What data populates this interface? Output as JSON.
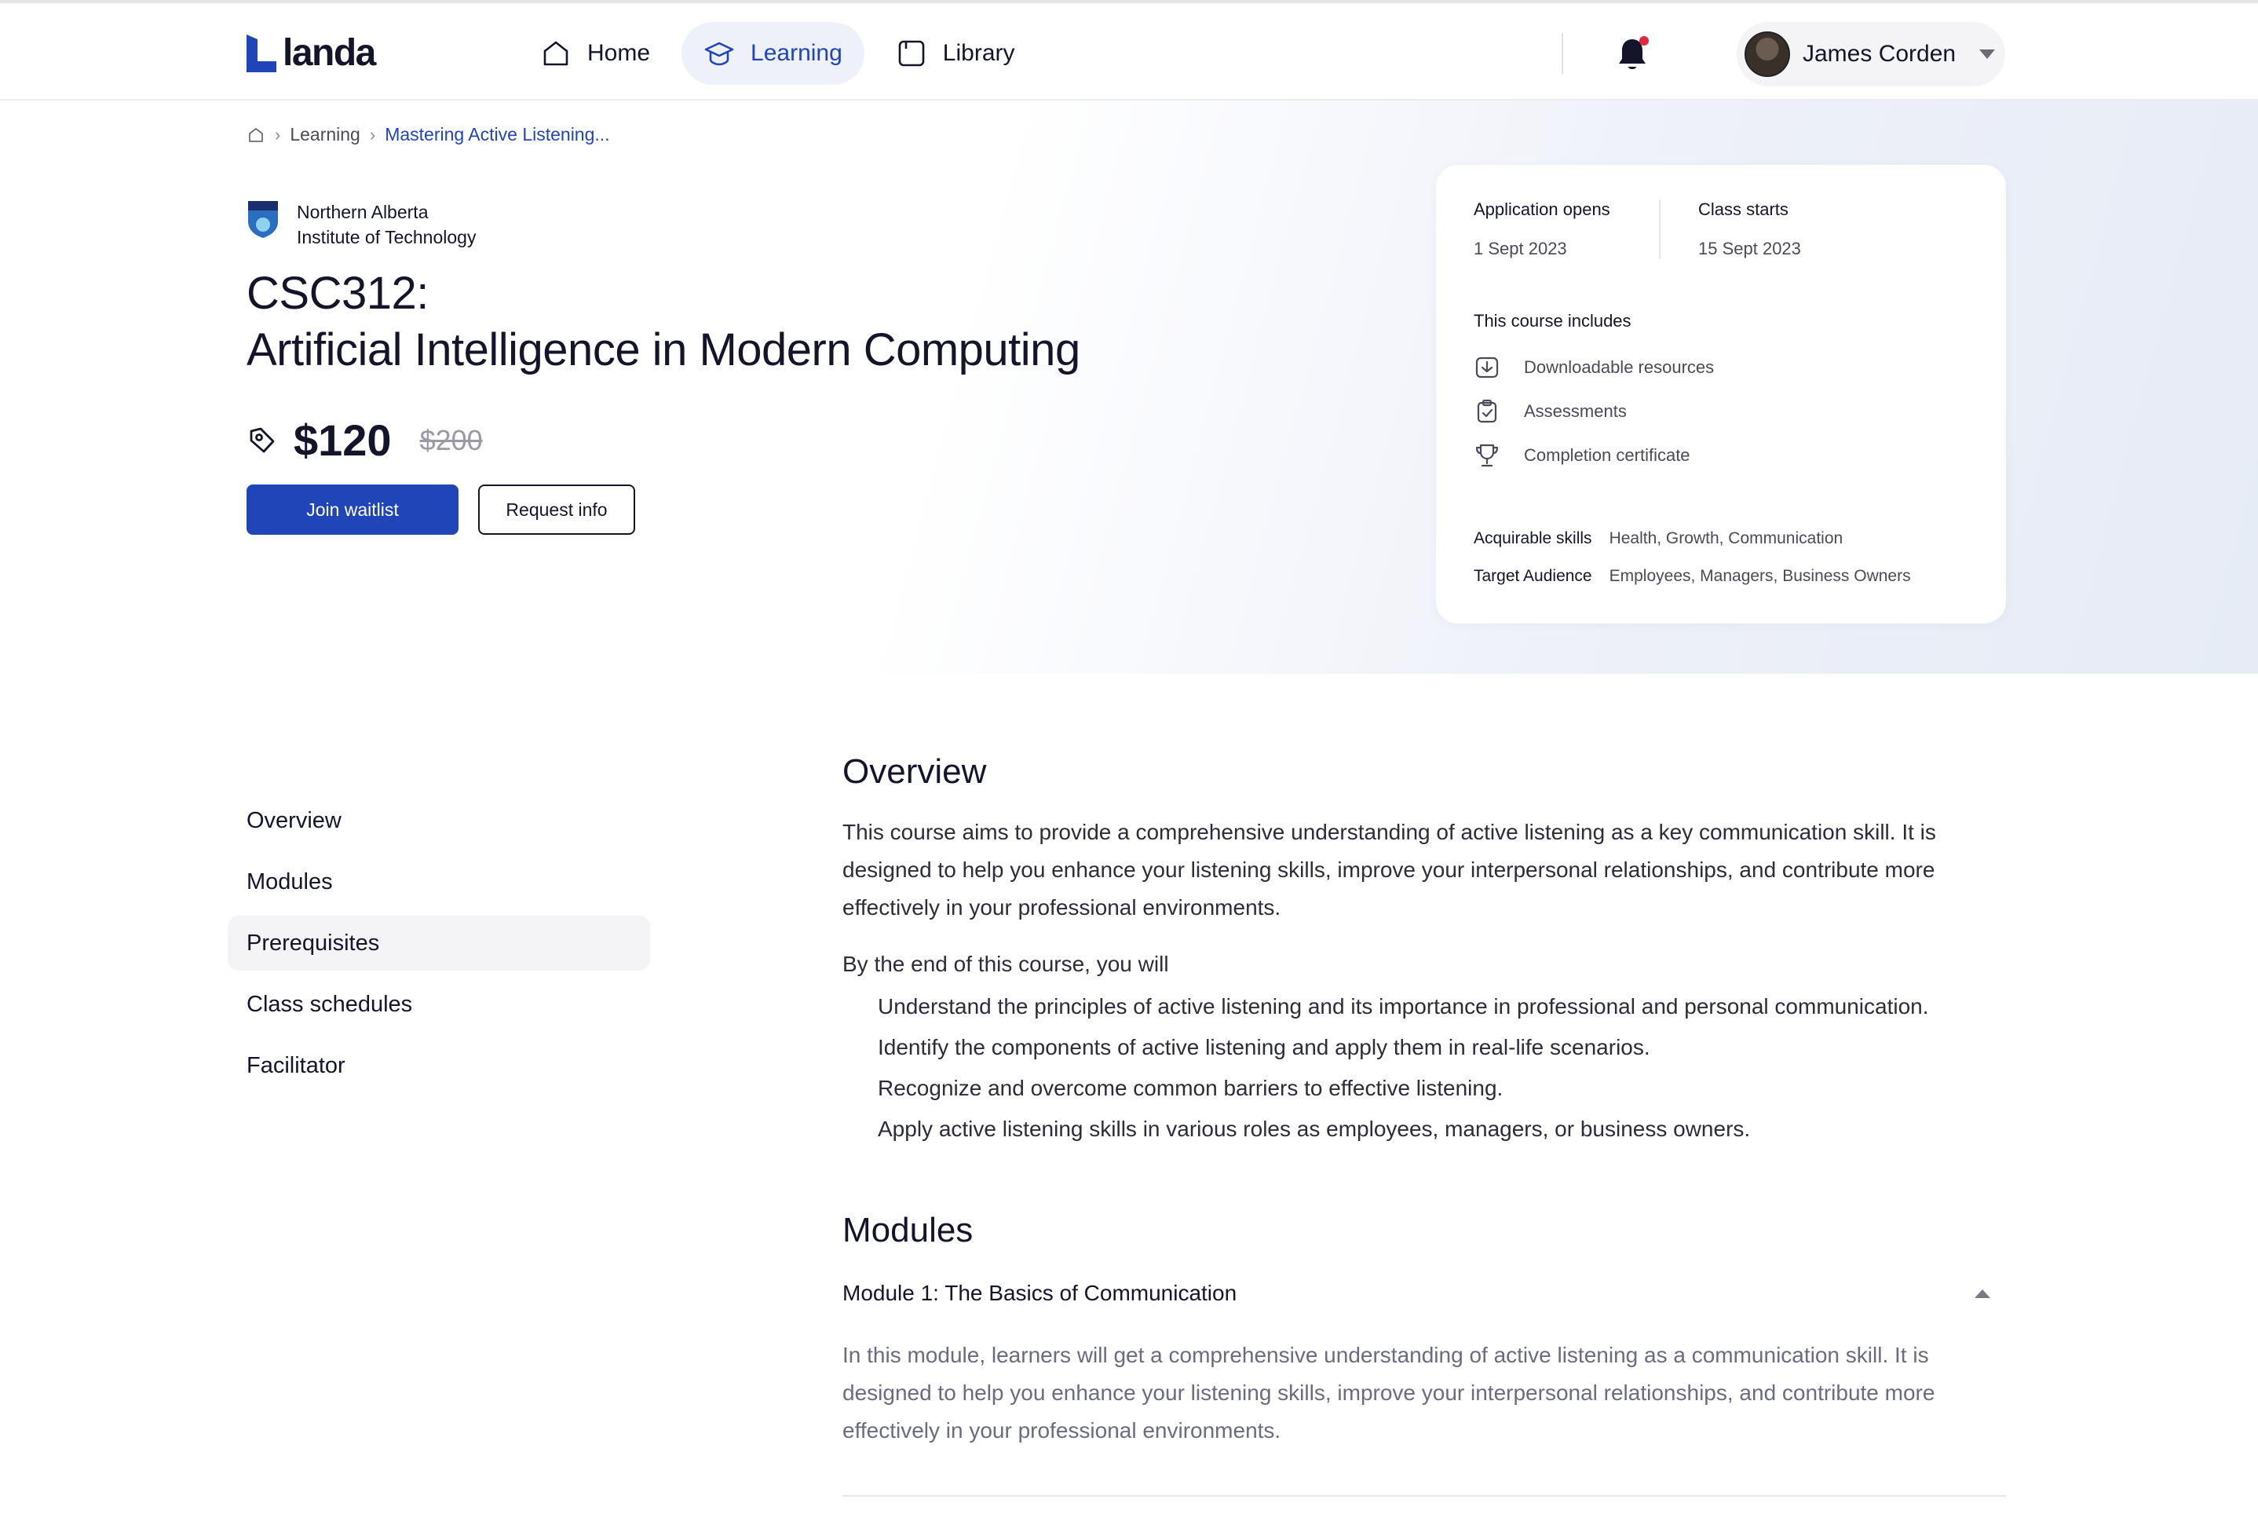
{
  "brand": {
    "name": "landa",
    "accent": "#1f45b8"
  },
  "nav": {
    "home": "Home",
    "learning": "Learning",
    "library": "Library"
  },
  "user": {
    "name": "James Corden"
  },
  "breadcrumb": {
    "section": "Learning",
    "current": "Mastering Active Listening..."
  },
  "institution": {
    "line1": "Northern Alberta",
    "line2": "Institute of Technology"
  },
  "course": {
    "code": "CSC312:",
    "name": "Artificial Intelligence in Modern Computing",
    "price": "$120",
    "old_price": "$200",
    "join_label": "Join waitlist",
    "info_label": "Request info"
  },
  "card": {
    "app_opens_label": "Application opens",
    "app_opens_value": "1 Sept 2023",
    "class_starts_label": "Class starts",
    "class_starts_value": "15 Sept 2023",
    "includes_title": "This course includes",
    "includes": [
      {
        "label": "Downloadable resources",
        "icon": "download-box-icon"
      },
      {
        "label": "Assessments",
        "icon": "clipboard-check-icon"
      },
      {
        "label": "Completion certificate",
        "icon": "trophy-icon"
      }
    ],
    "skills_label": "Acquirable skills",
    "skills_value": "Health, Growth, Communication",
    "audience_label": "Target Audience",
    "audience_value": "Employees, Managers, Business Owners"
  },
  "side_nav": [
    "Overview",
    "Modules",
    "Prerequisites",
    "Class schedules",
    "Facilitator"
  ],
  "overview": {
    "title": "Overview",
    "para_l1": "This course aims to provide a comprehensive understanding of active listening as a key communication skill. It is",
    "para_l2": "designed to help you enhance your listening skills, improve your interpersonal relationships, and contribute more",
    "para_l3": "effectively in your professional environments.",
    "intro": "By the end of this course, you will",
    "objectives": [
      "Understand the principles of active listening and its importance in professional and personal communication.",
      "Identify the components of active listening and apply them in real-life scenarios.",
      "Recognize and overcome common barriers to effective listening.",
      "Apply active listening skills in various roles   as employees, managers, or business owners."
    ]
  },
  "modules": {
    "title": "Modules",
    "module1_title": "Module 1: The Basics of Communication",
    "module1_l1": "In this module, learners will get a comprehensive understanding of active listening as a communication skill. It is",
    "module1_l2": "designed to help you enhance your listening skills, improve your interpersonal relationships, and contribute more",
    "module1_l3": "effectively in your professional environments."
  }
}
